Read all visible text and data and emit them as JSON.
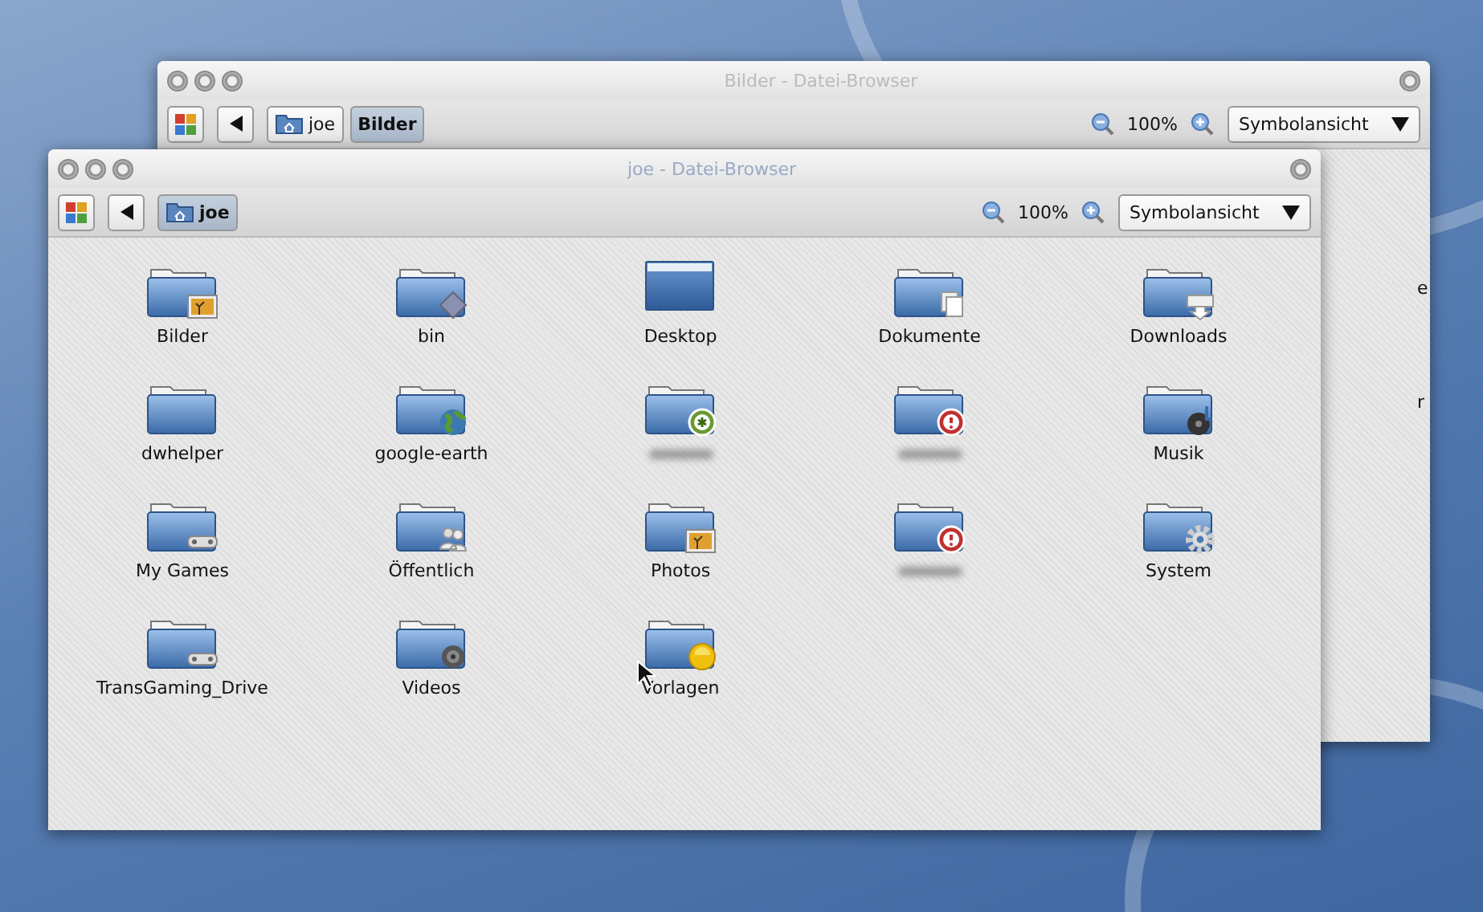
{
  "windows": [
    {
      "title": "Bilder - Datei-Browser",
      "focused": false,
      "path": [
        {
          "label": "joe",
          "selected": false
        },
        {
          "label": "Bilder",
          "selected": true
        }
      ],
      "zoom": "100%",
      "view": "Symbolansicht",
      "fragments": [
        "e",
        "r"
      ]
    },
    {
      "title": "joe - Datei-Browser",
      "focused": true,
      "path": [
        {
          "label": "joe",
          "selected": true
        }
      ],
      "zoom": "100%",
      "view": "Symbolansicht",
      "items": [
        {
          "kind": "pictures",
          "label": "Bilder"
        },
        {
          "kind": "link",
          "label": "bin"
        },
        {
          "kind": "desktop",
          "label": "Desktop"
        },
        {
          "kind": "documents",
          "label": "Dokumente"
        },
        {
          "kind": "downloads",
          "label": "Downloads"
        },
        {
          "kind": "plain",
          "label": "dwhelper"
        },
        {
          "kind": "globe",
          "label": "google-earth"
        },
        {
          "kind": "asterisk",
          "label_blurred": true
        },
        {
          "kind": "error",
          "label_blurred": true
        },
        {
          "kind": "music",
          "label": "Musik"
        },
        {
          "kind": "games",
          "label": "My Games"
        },
        {
          "kind": "people",
          "label": "Öffentlich"
        },
        {
          "kind": "pictures",
          "label": "Photos"
        },
        {
          "kind": "error",
          "label_blurred": true
        },
        {
          "kind": "gear",
          "label": "System"
        },
        {
          "kind": "games",
          "label": "TransGaming_Drive"
        },
        {
          "kind": "film",
          "label": "Videos"
        },
        {
          "kind": "star",
          "label": "Vorlagen"
        }
      ]
    }
  ]
}
